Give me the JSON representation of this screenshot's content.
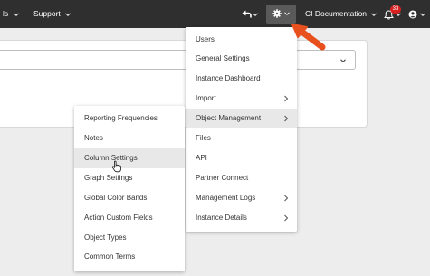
{
  "topbar": {
    "left_fragment": "ls",
    "support_label": "Support",
    "account_label": "CI Documentation",
    "notification_count": "33"
  },
  "admin_menu": {
    "items": [
      {
        "label": "Users",
        "submenu": false
      },
      {
        "label": "General Settings",
        "submenu": false
      },
      {
        "label": "Instance Dashboard",
        "submenu": false
      },
      {
        "label": "Import",
        "submenu": true
      },
      {
        "label": "Object Management",
        "submenu": true,
        "active": true
      },
      {
        "label": "Files",
        "submenu": false
      },
      {
        "label": "API",
        "submenu": false
      },
      {
        "label": "Partner Connect",
        "submenu": false
      },
      {
        "label": "Management Logs",
        "submenu": true
      },
      {
        "label": "Instance Details",
        "submenu": true
      }
    ]
  },
  "object_menu": {
    "items": [
      {
        "label": "Reporting Frequencies"
      },
      {
        "label": "Notes"
      },
      {
        "label": "Column Settings",
        "active": true
      },
      {
        "label": "Graph Settings"
      },
      {
        "label": "Global Color Bands"
      },
      {
        "label": "Action Custom Fields"
      },
      {
        "label": "Object Types"
      },
      {
        "label": "Common Terms"
      }
    ]
  },
  "colors": {
    "topbar": "#2f2f2f",
    "gear_active": "#5a5a5a",
    "badge": "#d72020",
    "annotation_arrow": "#e8501e",
    "hover": "#e8e8e8"
  }
}
